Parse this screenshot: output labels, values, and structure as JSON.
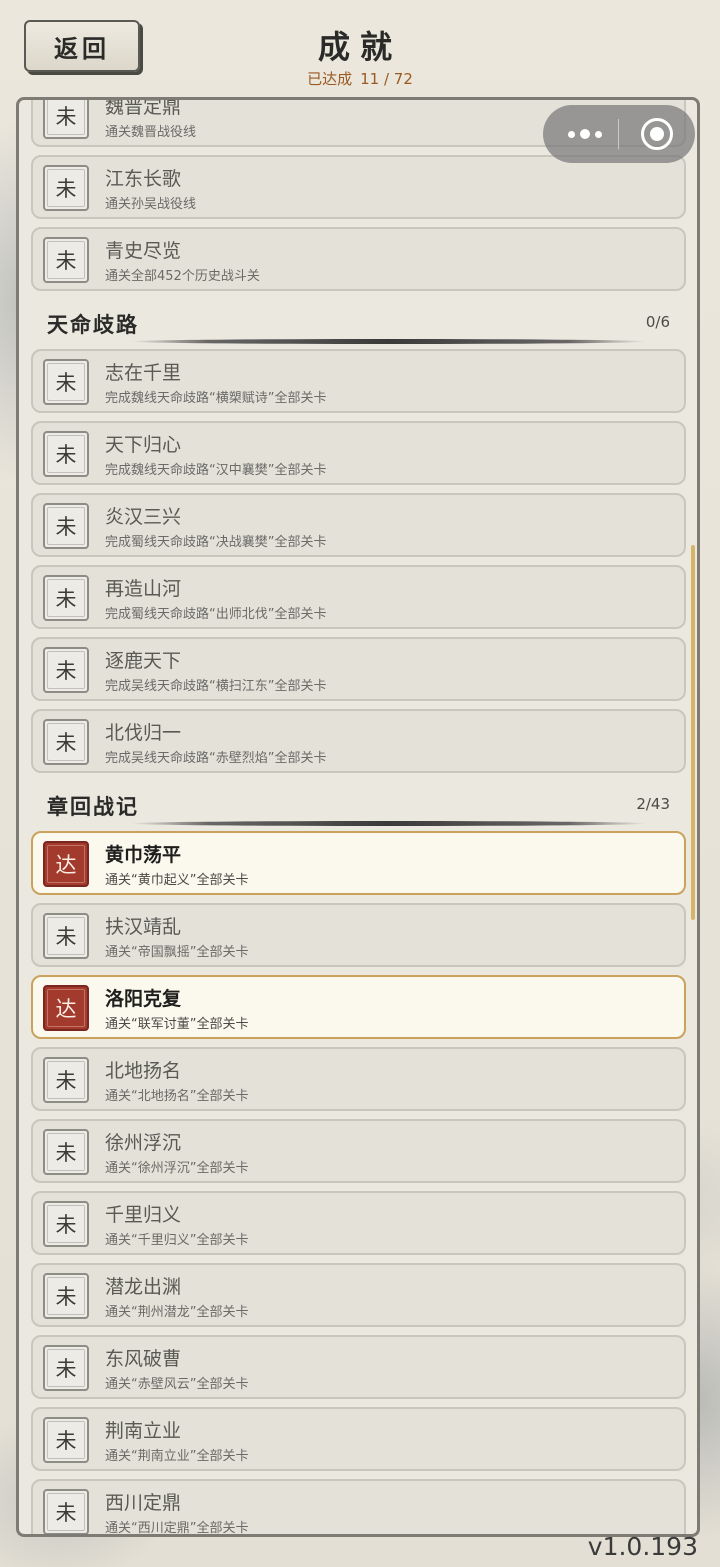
{
  "header": {
    "back_label": "返回",
    "title": "成就",
    "progress_label": "已达成",
    "progress_value": "11 / 72"
  },
  "mini_program": {
    "more_icon": "more-dots-icon",
    "close_icon": "target-circle-icon"
  },
  "sections": [
    {
      "title": "",
      "count": "",
      "items": [
        {
          "status": "未",
          "title": "魏晋定鼎",
          "desc": "通关魏晋战役线",
          "done": false
        },
        {
          "status": "未",
          "title": "江东长歌",
          "desc": "通关孙吴战役线",
          "done": false
        },
        {
          "status": "未",
          "title": "青史尽览",
          "desc": "通关全部452个历史战斗关",
          "done": false
        }
      ]
    },
    {
      "title": "天命歧路",
      "count": "0/6",
      "items": [
        {
          "status": "未",
          "title": "志在千里",
          "desc": "完成魏线天命歧路“横槊赋诗”全部关卡",
          "done": false
        },
        {
          "status": "未",
          "title": "天下归心",
          "desc": "完成魏线天命歧路“汉中襄樊”全部关卡",
          "done": false
        },
        {
          "status": "未",
          "title": "炎汉三兴",
          "desc": "完成蜀线天命歧路“决战襄樊”全部关卡",
          "done": false
        },
        {
          "status": "未",
          "title": "再造山河",
          "desc": "完成蜀线天命歧路“出师北伐”全部关卡",
          "done": false
        },
        {
          "status": "未",
          "title": "逐鹿天下",
          "desc": "完成吴线天命歧路“横扫江东”全部关卡",
          "done": false
        },
        {
          "status": "未",
          "title": "北伐归一",
          "desc": "完成吴线天命歧路“赤壁烈焰”全部关卡",
          "done": false
        }
      ]
    },
    {
      "title": "章回战记",
      "count": "2/43",
      "items": [
        {
          "status": "达",
          "title": "黄巾荡平",
          "desc": "通关“黄巾起义”全部关卡",
          "done": true
        },
        {
          "status": "未",
          "title": "扶汉靖乱",
          "desc": "通关“帝国飘摇”全部关卡",
          "done": false
        },
        {
          "status": "达",
          "title": "洛阳克复",
          "desc": "通关“联军讨董”全部关卡",
          "done": true
        },
        {
          "status": "未",
          "title": "北地扬名",
          "desc": "通关“北地扬名”全部关卡",
          "done": false
        },
        {
          "status": "未",
          "title": "徐州浮沉",
          "desc": "通关“徐州浮沉”全部关卡",
          "done": false
        },
        {
          "status": "未",
          "title": "千里归义",
          "desc": "通关“千里归义”全部关卡",
          "done": false
        },
        {
          "status": "未",
          "title": "潜龙出渊",
          "desc": "通关“荆州潜龙”全部关卡",
          "done": false
        },
        {
          "status": "未",
          "title": "东风破曹",
          "desc": "通关“赤壁风云”全部关卡",
          "done": false
        },
        {
          "status": "未",
          "title": "荆南立业",
          "desc": "通关“荆南立业”全部关卡",
          "done": false
        },
        {
          "status": "未",
          "title": "西川定鼎",
          "desc": "通关“西川定鼎”全部关卡",
          "done": false
        }
      ]
    }
  ],
  "version": "v1.0.193"
}
